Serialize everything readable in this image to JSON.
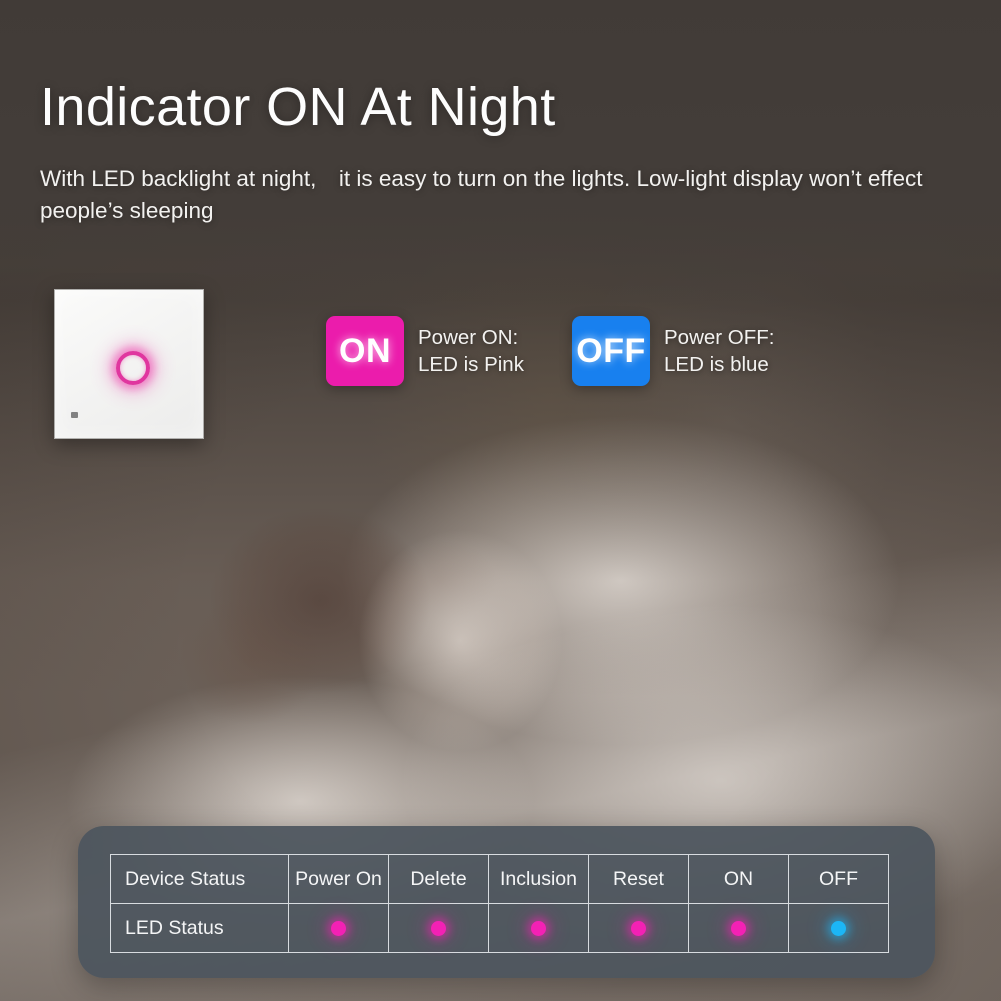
{
  "headline": "Indicator ON At Night",
  "subtitle": "With LED backlight at night, it is easy to turn on the lights. Low-light display won’t effect people’s sleeping",
  "colors": {
    "pink": "#eb1cac",
    "blue": "#1880ef",
    "led_pink": "#f321b4",
    "led_blue": "#1cb6f6",
    "panel": "#4c555e",
    "header_bg": "#413b37",
    "switch_ring": "#e0369f"
  },
  "switch": {
    "indicator_state": "pink-glow-ring"
  },
  "legend": [
    {
      "badge": "ON",
      "line1": "Power ON:",
      "line2": "LED is Pink"
    },
    {
      "badge": "OFF",
      "line1": "Power OFF:",
      "line2": "LED is blue"
    }
  ],
  "status_table": {
    "row_labels": [
      "Device Status",
      "LED Status"
    ],
    "columns": [
      "Power On",
      "Delete",
      "Inclusion",
      "Reset",
      "ON",
      "OFF"
    ],
    "led_states": [
      "pink",
      "pink",
      "pink",
      "pink",
      "pink",
      "blue"
    ]
  }
}
